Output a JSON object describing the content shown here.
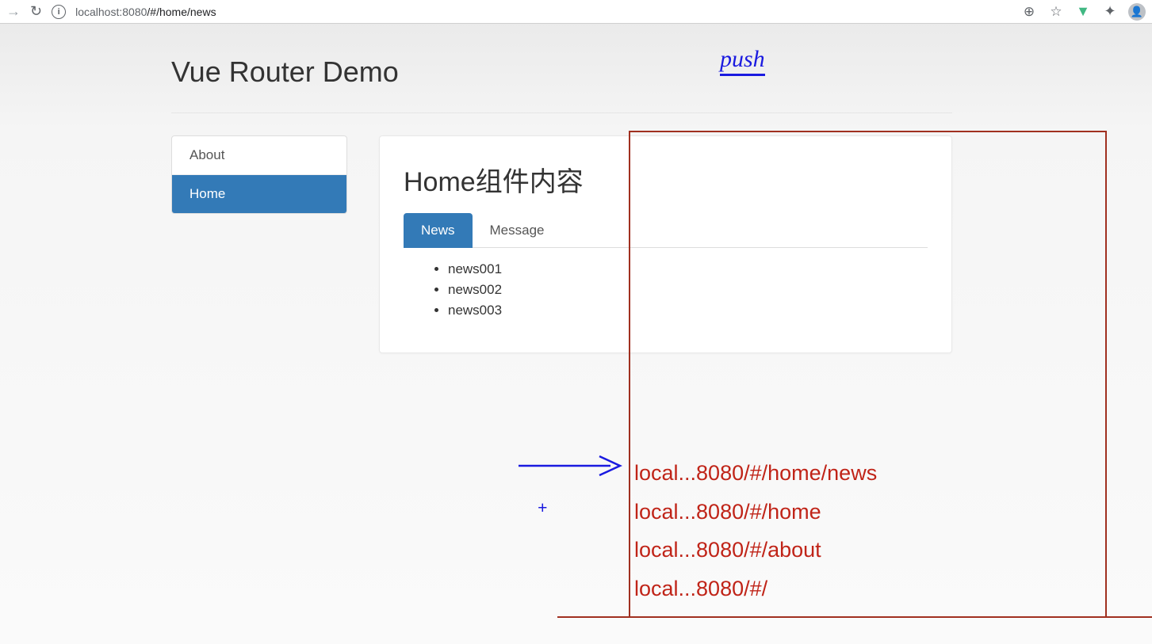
{
  "browser": {
    "url_host": "localhost",
    "url_port": ":8080",
    "url_path": "/#/home/news",
    "info_glyph": "i",
    "arrow_glyph": "→",
    "reload_glyph": "↻",
    "search_glyph": "⊕",
    "star_glyph": "☆",
    "vue_glyph": "▼",
    "puzzle_glyph": "✦",
    "avatar_glyph": "👤"
  },
  "page": {
    "title": "Vue Router Demo"
  },
  "sidebar": {
    "items": [
      {
        "label": "About",
        "active": false
      },
      {
        "label": "Home",
        "active": true
      }
    ]
  },
  "content": {
    "heading": "Home组件内容",
    "tabs": [
      {
        "label": "News",
        "active": true
      },
      {
        "label": "Message",
        "active": false
      }
    ],
    "news": [
      "news001",
      "news002",
      "news003"
    ]
  },
  "annotations": {
    "push_label": "push",
    "plus_glyph": "+",
    "history_stack": [
      "local...8080/#/home/news",
      "local...8080/#/home",
      "local...8080/#/about",
      "local...8080/#/"
    ]
  }
}
